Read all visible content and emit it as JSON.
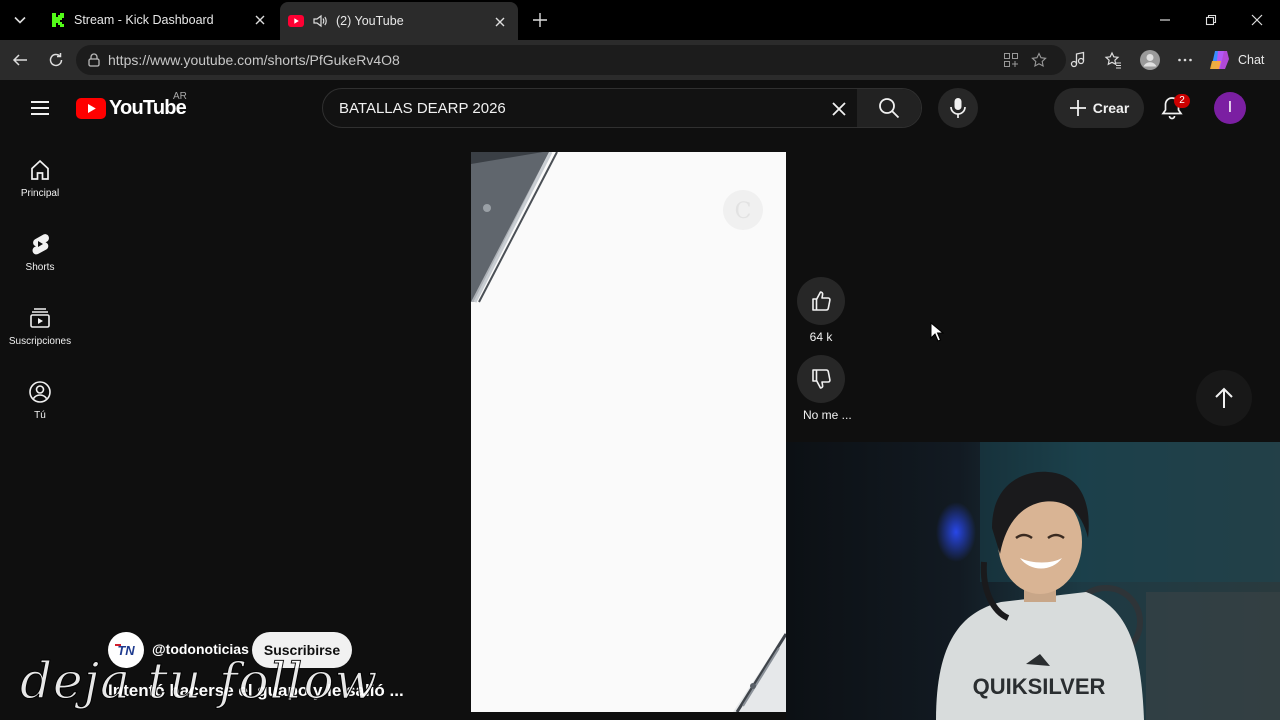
{
  "browser": {
    "tabs": [
      {
        "title": "Stream - Kick Dashboard",
        "active": false,
        "favicon": "kick-icon"
      },
      {
        "title": "(2) YouTube",
        "active": true,
        "favicon": "youtube-icon",
        "audio": "speaker-icon"
      }
    ],
    "url": "https://www.youtube.com/shorts/PfGukeRv4O8",
    "copilot_label": "Chat"
  },
  "youtube": {
    "country_code": "AR",
    "search_query": "BATALLAS DEARP 2026",
    "create_label": "Crear",
    "notification_count": "2",
    "avatar_letter": "I",
    "sidebar": [
      {
        "label": "Principal",
        "icon": "home-icon"
      },
      {
        "label": "Shorts",
        "icon": "shorts-icon"
      },
      {
        "label": "Suscripciones",
        "icon": "subscriptions-icon"
      },
      {
        "label": "Tú",
        "icon": "you-icon"
      }
    ],
    "actions": {
      "like_count": "64 k",
      "dislike_label": "No me ..."
    },
    "channel": {
      "name": "@todonoticias",
      "avatar_text": "TN",
      "subscribe_label": "Suscribirse"
    },
    "video_title": "Intentó hacerse el guapo y le salió ..."
  },
  "overlay": {
    "handwritten_text": "deja tu follow"
  },
  "colors": {
    "bg": "#0f0f0f",
    "youtube_red": "#ff0000",
    "kick_green": "#53fc18",
    "avatar": "#7b1fa2"
  }
}
